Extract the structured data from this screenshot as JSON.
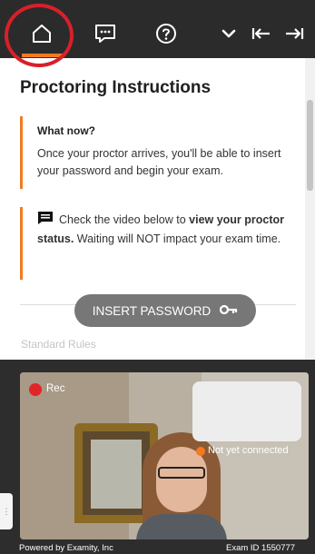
{
  "toolbar": {
    "icons": [
      "home-icon",
      "chat-icon",
      "help-icon",
      "chevron-down-icon",
      "collapse-left-icon",
      "expand-right-icon"
    ],
    "accent_color": "#f47a20",
    "highlight_color": "#d8202a"
  },
  "instructions": {
    "title": "Proctoring Instructions",
    "what_now": {
      "heading": "What now?",
      "body": "Once your proctor arrives, you'll be able to insert your password and begin your exam."
    },
    "status_note": {
      "icon": "message-icon",
      "text_before": "Check the video below to ",
      "text_bold": "view your proctor status.",
      "text_after": " Waiting will NOT impact your exam time."
    },
    "insert_password_label": "INSERT PASSWORD",
    "insert_password_icon": "key-icon",
    "standard_rules_label": "Standard Rules"
  },
  "video": {
    "rec_label": "Rec",
    "status_label": "Not yet connected"
  },
  "footer": {
    "powered_by": "Powered by Examity, Inc",
    "exam_id": "Exam ID 1550777"
  }
}
